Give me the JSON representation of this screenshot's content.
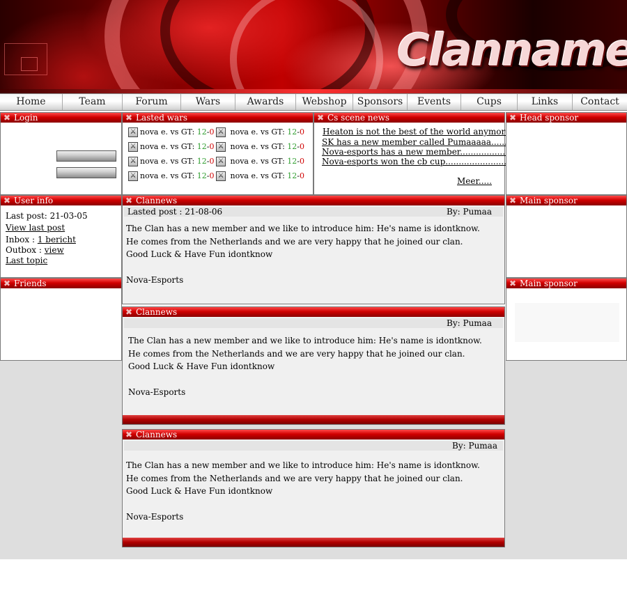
{
  "header": {
    "title": "Clanname"
  },
  "nav": {
    "items": [
      {
        "label": "Home"
      },
      {
        "label": "Team"
      },
      {
        "label": "Forum"
      },
      {
        "label": "Wars"
      },
      {
        "label": "Awards"
      },
      {
        "label": "Webshop"
      },
      {
        "label": "Sponsors"
      },
      {
        "label": "Events"
      },
      {
        "label": "Cups"
      },
      {
        "label": "Links"
      },
      {
        "label": "Contact"
      }
    ]
  },
  "login": {
    "title": "Login"
  },
  "wars": {
    "title": "Lasted wars",
    "items": [
      {
        "text": "nova e. vs GT:",
        "win": "12",
        "sep": "-",
        "loss": "0"
      },
      {
        "text": "nova e. vs GT:",
        "win": "12",
        "sep": "-",
        "loss": "0"
      },
      {
        "text": "nova e. vs GT:",
        "win": "12",
        "sep": "-",
        "loss": "0"
      },
      {
        "text": "nova e. vs GT:",
        "win": "12",
        "sep": "-",
        "loss": "0"
      },
      {
        "text": "nova e. vs GT:",
        "win": "12",
        "sep": "-",
        "loss": "0"
      },
      {
        "text": "nova e. vs GT:",
        "win": "12",
        "sep": "-",
        "loss": "0"
      },
      {
        "text": "nova e. vs GT:",
        "win": "12",
        "sep": "-",
        "loss": "0"
      },
      {
        "text": "nova e. vs GT:",
        "win": "12",
        "sep": "-",
        "loss": "0"
      }
    ]
  },
  "cs_news": {
    "title": "Cs scene news",
    "items": [
      {
        "label": "Heaton is not the best of the world anymore"
      },
      {
        "label": "SK has a new member called Pumaaaaa......"
      },
      {
        "label": "Nova-esports has a new member...................."
      },
      {
        "label": "Nova-esports won the cb cup............................"
      }
    ],
    "more": "Meer....."
  },
  "head_sponsor": {
    "title": "Head sponsor"
  },
  "user_info": {
    "title": "User info",
    "last_post": "Last post: 21-03-05",
    "view_last_post": "View last post",
    "inbox_label": "Inbox :",
    "inbox_link": "1 bericht",
    "outbox_label": "Outbox :",
    "outbox_link": "view",
    "last_topic": "Last topic"
  },
  "friends": {
    "title": "Friends"
  },
  "main_sponsor_1": {
    "title": "Main sponsor"
  },
  "main_sponsor_2": {
    "title": "Main sponsor"
  },
  "news": [
    {
      "title": "Clannews",
      "lasted_post": "Lasted post : 21-08-06",
      "by": "By:  Pumaa",
      "lines": [
        "The Clan has a new member and we like to introduce him: He's name is idontknow.",
        "He comes from the Netherlands and we are very happy that he joined our clan.",
        "Good Luck & Have Fun idontknow",
        "",
        "Nova-Esports"
      ]
    },
    {
      "title": "Clannews",
      "lasted_post": "",
      "by": "By:  Pumaa",
      "lines": [
        "The Clan has a new member and we like to introduce him: He's name is idontknow.",
        "He comes from the Netherlands and we are very happy that he joined our clan.",
        "Good Luck & Have Fun idontknow",
        "",
        "Nova-Esports"
      ]
    },
    {
      "title": "Clannews",
      "lasted_post": "",
      "by": "By:  Pumaa",
      "lines": [
        "The Clan has a new member and we like to introduce him: He's name is idontknow.",
        "He comes from the Netherlands and we are very happy that he joined our clan.",
        "Good Luck & Have Fun idontknow",
        "",
        "Nova-Esports"
      ]
    }
  ]
}
